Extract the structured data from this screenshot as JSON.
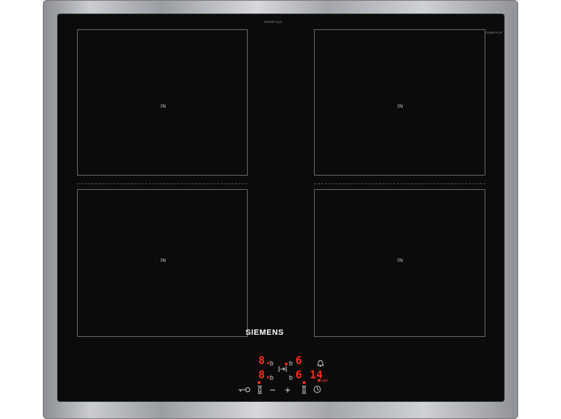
{
  "model_top": "EX645FCQ1E",
  "model_right": "EX645FXC1E",
  "brand": "SIEMENS",
  "zones": [
    {
      "label": "IN"
    },
    {
      "label": "IN"
    },
    {
      "label": "IN"
    },
    {
      "label": "IN"
    }
  ],
  "display": {
    "row1_left_digit": "8.",
    "row1_left_b": "b",
    "row1_mid_b": "b",
    "row1_right_digit": "6",
    "row2_left_digit": "8.",
    "row2_left_b": "b",
    "row2_mid_b": "b",
    "row2_right_digit": "6",
    "timer_value": "14",
    "timer_unit": "min"
  },
  "controls": {
    "minus": "−",
    "plus": "+"
  },
  "icons": [
    "key-lock-icon",
    "zone-select-icon",
    "minus-icon",
    "plus-icon",
    "zone-select-icon",
    "timer-clock-icon",
    "bell-icon",
    "transfer-icon"
  ],
  "colors": {
    "glass": "#0b0b0c",
    "display_red": "#ff2a1a",
    "frame": "#b0b3b7"
  }
}
